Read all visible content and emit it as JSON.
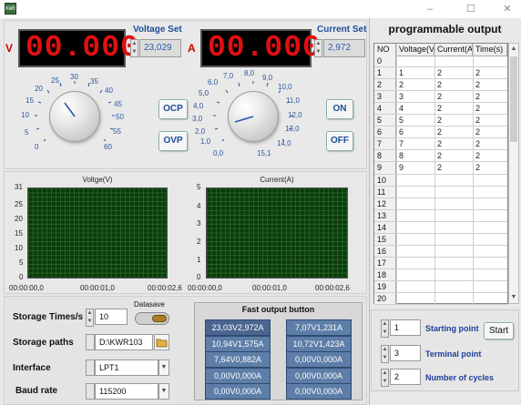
{
  "window": {
    "icon_text": "KWR",
    "controls": [
      "–",
      "☐",
      "✕"
    ]
  },
  "voltage": {
    "label": "V",
    "display": "00.000",
    "set_label": "Voltage Set",
    "set_value": "23,029"
  },
  "current": {
    "label": "A",
    "display": "00.000",
    "set_label": "Current Set",
    "set_value": "2,972"
  },
  "voltage_dial": {
    "ticks": [
      "0",
      "5",
      "10",
      "15",
      "20",
      "25",
      "30",
      "35",
      "40",
      "45",
      "50",
      "55",
      "60"
    ],
    "value": 23.029
  },
  "current_dial": {
    "ticks": [
      "0,0",
      "1,0",
      "2,0",
      "3,0",
      "4,0",
      "5,0",
      "6,0",
      "7,0",
      "8,0",
      "9,0",
      "10,0",
      "11,0",
      "12,0",
      "13,0",
      "14,0",
      "15,1"
    ],
    "value": 2.972
  },
  "buttons": {
    "ocp": "OCP",
    "ovp": "OVP",
    "on": "ON",
    "off": "OFF",
    "start": "Start"
  },
  "chart_data": [
    {
      "type": "line",
      "title": "Voltge(V)",
      "ylim": [
        0,
        31
      ],
      "yticks": [
        "31",
        "25",
        "20",
        "15",
        "10",
        "5",
        "0"
      ],
      "xticks": [
        "00:00:00,0",
        "00:00:01,0",
        "00:00:02,6"
      ],
      "grid": true,
      "series": []
    },
    {
      "type": "line",
      "title": "Current(A)",
      "ylim": [
        0,
        5
      ],
      "yticks": [
        "5",
        "4",
        "3",
        "2",
        "1",
        "0"
      ],
      "xticks": [
        "00:00:00,0",
        "00:00:01,0",
        "00:00:02,6"
      ],
      "grid": true,
      "series": []
    }
  ],
  "settings": {
    "storage_times_label": "Storage Times/s",
    "storage_times_value": "10",
    "datasave_label": "Datasave",
    "storage_paths_label": "Storage paths",
    "storage_paths_value": "D:\\KWR103",
    "interface_label": "Interface",
    "interface_value": "LPT1",
    "baud_rate_label": "Baud rate",
    "baud_rate_value": "115200"
  },
  "fast_output": {
    "title": "Fast output button",
    "buttons": [
      "23,03V2,972A",
      "7,07V1,231A",
      "10,94V1,575A",
      "10,72V1,423A",
      "7,64V0,882A",
      "0,00V0,000A",
      "0,00V0,000A",
      "0,00V0,000A",
      "0,00V0,000A",
      "0,00V0,000A"
    ]
  },
  "program": {
    "title": "programmable output",
    "headers": [
      "NO",
      "Voltage(V",
      "Current(A",
      "Time(s)"
    ],
    "row_numbers": [
      "0",
      "1",
      "2",
      "3",
      "4",
      "5",
      "6",
      "7",
      "8",
      "9",
      "10",
      "11",
      "12",
      "13",
      "14",
      "15",
      "16",
      "17",
      "18",
      "19",
      "20"
    ],
    "rows": [
      [
        "1",
        "2",
        "2"
      ],
      [
        "2",
        "2",
        "2"
      ],
      [
        "3",
        "2",
        "2"
      ],
      [
        "4",
        "2",
        "2"
      ],
      [
        "5",
        "2",
        "2"
      ],
      [
        "6",
        "2",
        "2"
      ],
      [
        "7",
        "2",
        "2"
      ],
      [
        "8",
        "2",
        "2"
      ],
      [
        "9",
        "2",
        "2"
      ]
    ],
    "starting_point_label": "Starting point",
    "starting_point_value": "1",
    "terminal_point_label": "Terminal point",
    "terminal_point_value": "3",
    "cycles_label": "Number of cycles",
    "cycles_value": "2"
  }
}
